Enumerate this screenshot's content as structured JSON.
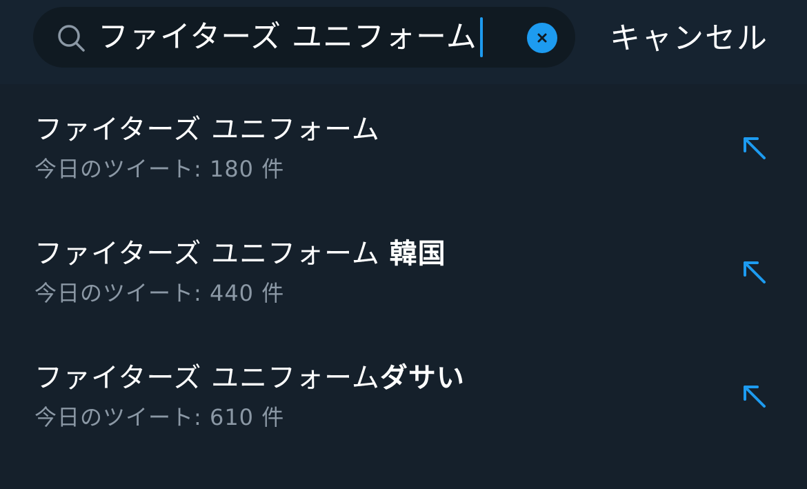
{
  "search": {
    "value": "ファイターズ ユニフォーム",
    "clear_icon": "x-icon",
    "cancel_label": "キャンセル"
  },
  "suggestions": [
    {
      "title_base": "ファイターズ ユニフォーム",
      "title_bold": "",
      "meta": "今日のツイート: 180 件"
    },
    {
      "title_base": "ファイターズ ユニフォーム ",
      "title_bold": "韓国",
      "meta": "今日のツイート: 440 件"
    },
    {
      "title_base": "ファイターズ ユニフォーム",
      "title_bold": "ダサい",
      "meta": "今日のツイート: 610 件"
    }
  ],
  "colors": {
    "background": "#15202b",
    "accent": "#1d9bf0",
    "secondary_text": "#8b98a5"
  }
}
